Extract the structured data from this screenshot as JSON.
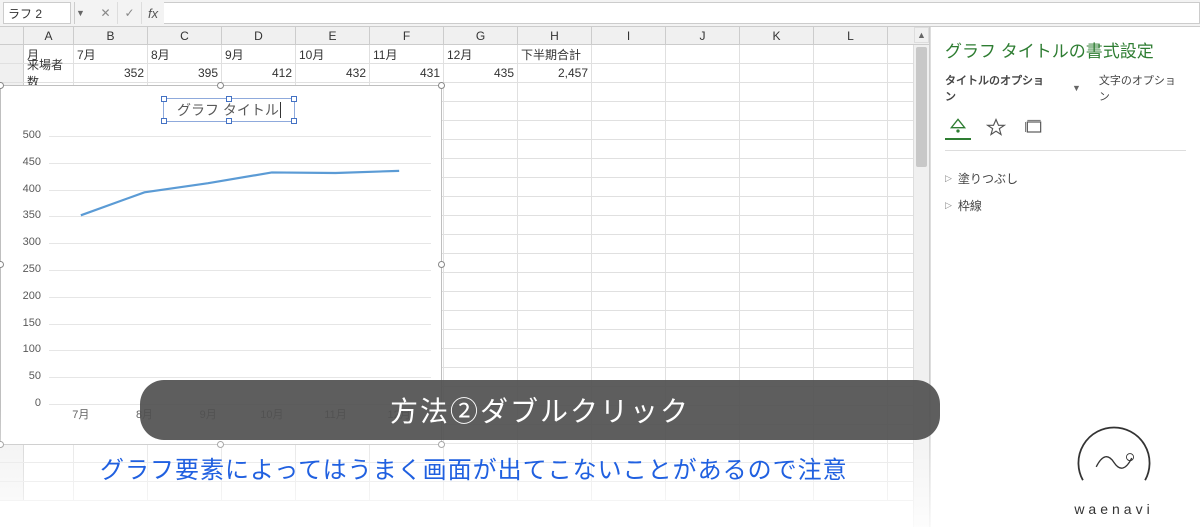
{
  "name_box": "ラフ 2",
  "formula": "",
  "columns": [
    "A",
    "B",
    "C",
    "D",
    "E",
    "F",
    "G",
    "H",
    "I",
    "J",
    "K",
    "L"
  ],
  "row1": {
    "label": "月",
    "cells": [
      "7月",
      "8月",
      "9月",
      "10月",
      "11月",
      "12月",
      "下半期合計",
      "",
      "",
      "",
      "",
      ""
    ]
  },
  "row2": {
    "label": "来場者数",
    "cells": [
      "352",
      "395",
      "412",
      "432",
      "431",
      "435",
      "2,457",
      "",
      "",
      "",
      "",
      ""
    ]
  },
  "chart_title_edit": "グラフ タイトル",
  "chart_data": {
    "type": "line",
    "title": "グラフ タイトル",
    "categories": [
      "7月",
      "8月",
      "9月",
      "10月",
      "11月",
      "12月"
    ],
    "values": [
      352,
      395,
      412,
      432,
      431,
      435
    ],
    "ylim": [
      0,
      500
    ],
    "ystep": 50,
    "xlabel": "",
    "ylabel": ""
  },
  "format_panel": {
    "title": "グラフ タイトルの書式設定",
    "sub_bold": "タイトルのオプション",
    "sub_plain": "文字のオプション",
    "items": [
      "塗りつぶし",
      "枠線"
    ]
  },
  "overlay": {
    "callout": "方法②ダブルクリック",
    "caption": "グラフ要素によってはうまく画面が出てこないことがあるので注意"
  },
  "brand": "waenavi"
}
